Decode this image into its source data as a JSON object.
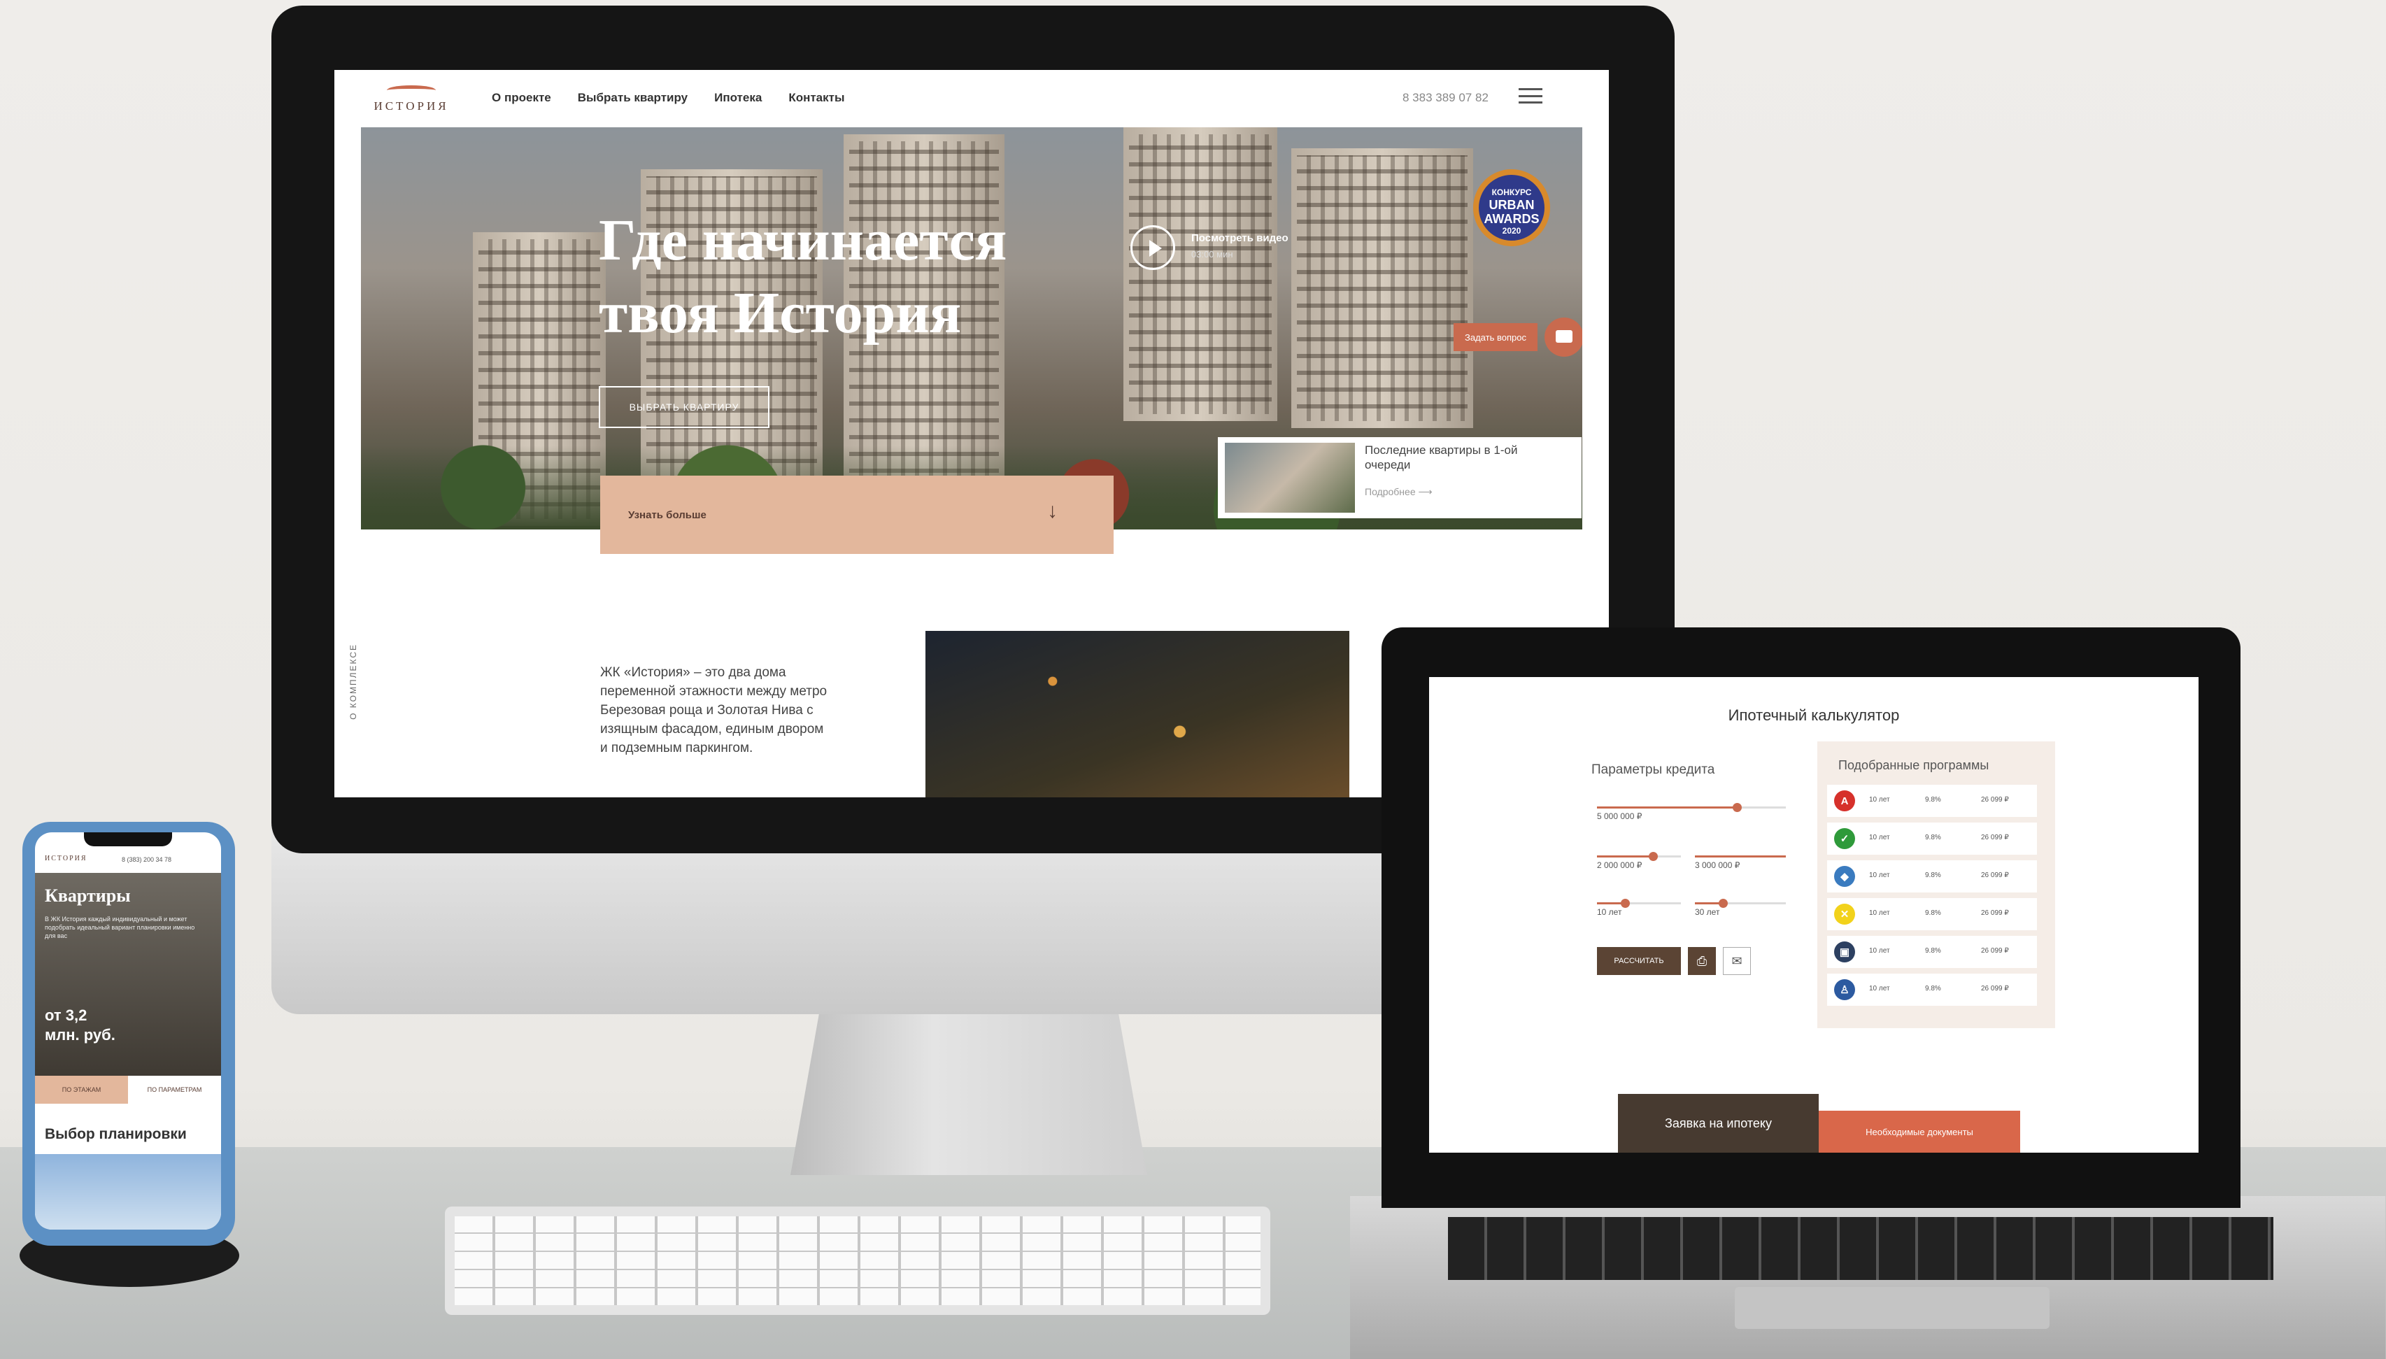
{
  "site": {
    "logo_text": "ИСТОРИЯ",
    "nav": [
      "О проекте",
      "Выбрать квартиру",
      "Ипотека",
      "Контакты"
    ],
    "phone": "8 383 389 07 82"
  },
  "hero": {
    "title": "Где начинается твоя История",
    "choose_button": "ВЫБРАТЬ КВАРТИРУ",
    "video_label": "Посмотреть видео",
    "video_time": "03:00 мин",
    "award_top": "КОНКУРС",
    "award_urban": "URBAN",
    "award_awards": "AWARDS",
    "award_year": "2020",
    "ask_button": "Задать вопрос",
    "learn_more": "Узнать больше",
    "last_flats_title": "Последние квартиры в 1-ой очереди",
    "last_flats_link": "Подробнее"
  },
  "about": {
    "vertical_label": "О КОМПЛЕКСЕ",
    "text": "ЖК «История» – это два дома переменной этажности между метро Березовая роща и Золотая Нива с изящным фасадом, единым двором и подземным паркингом."
  },
  "calculator": {
    "title": "Ипотечный калькулятор",
    "params_title": "Параметры кредита",
    "val1": "5 000 000 ₽",
    "val2": "2 000 000 ₽",
    "val3": "3 000 000 ₽",
    "val4": "10 лет",
    "val5": "30 лет",
    "calc_button": "РАССЧИТАТЬ",
    "programs_title": "Подобранные программы",
    "programs": [
      {
        "term": "10 лет",
        "rate": "9.8%",
        "payment": "26 099 ₽",
        "color": "#d6312b",
        "mark": "А"
      },
      {
        "term": "10 лет",
        "rate": "9.8%",
        "payment": "26 099 ₽",
        "color": "#2f9a3a",
        "mark": "✓"
      },
      {
        "term": "10 лет",
        "rate": "9.8%",
        "payment": "26 099 ₽",
        "color": "#3a7bbf",
        "mark": "◆"
      },
      {
        "term": "10 лет",
        "rate": "9.8%",
        "payment": "26 099 ₽",
        "color": "#f2d21b",
        "mark": "✕"
      },
      {
        "term": "10 лет",
        "rate": "9.8%",
        "payment": "26 099 ₽",
        "color": "#2d4061",
        "mark": "▣"
      },
      {
        "term": "10 лет",
        "rate": "9.8%",
        "payment": "26 099 ₽",
        "color": "#2c5aa0",
        "mark": "♙"
      }
    ],
    "cta": "Заявка на ипотеку",
    "docs": "Необходимые документы"
  },
  "mobile": {
    "logo_text": "ИСТОРИЯ",
    "phone": "8 (383) 200 34 78",
    "title": "Квартиры",
    "text": "В ЖК История каждый индивидуальный и может подобрать идеальный вариант планировки именно для вас",
    "price_from": "от 3,2",
    "price_unit": "млн. руб.",
    "tab_floor": "ПО ЭТАЖАМ",
    "tab_plan": "ПО ПАРАМЕТРАМ",
    "plan_title": "Выбор планировки"
  }
}
